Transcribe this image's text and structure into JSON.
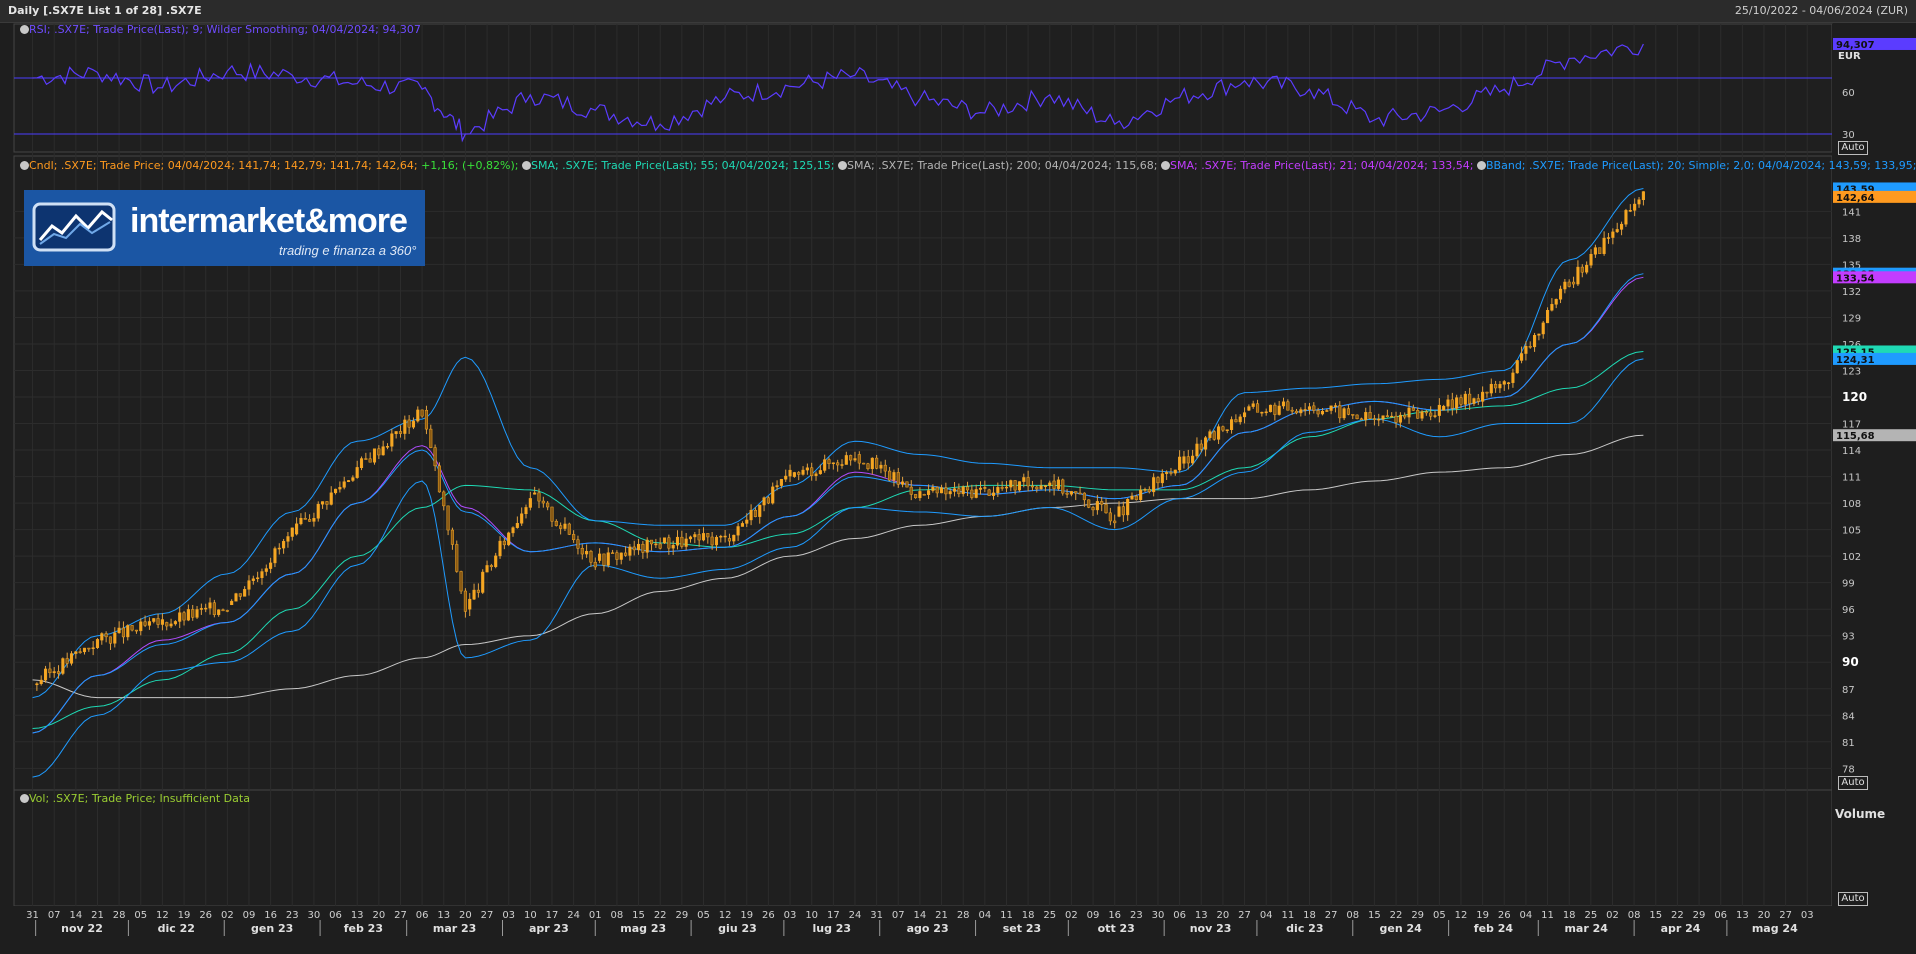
{
  "window": {
    "title": "Daily [.SX7E List 1 of 28] .SX7E",
    "date_range": "25/10/2022 - 04/06/2024 (ZUR)"
  },
  "rsi_panel": {
    "legend": "RSI; .SX7E; Trade Price(Last);  9; Wilder Smoothing; 04/04/2024; 94,307",
    "ticks": [
      "60",
      "30"
    ],
    "last_value": "94,307",
    "currency": "EUR",
    "auto_label": "Auto",
    "overbought": 70,
    "oversold": 30
  },
  "price_panel": {
    "legend": {
      "cndl": "Cndl; .SX7E; Trade Price; 04/04/2024; 141,74; 142,79; 141,74; 142,64; ",
      "cndl_change": "+1,16; (+0,82%);",
      "sma55": "SMA; .SX7E; Trade Price(Last);  55; 04/04/2024; 125,15;",
      "sma200": "SMA; .SX7E; Trade Price(Last);  200; 04/04/2024; 115,68;",
      "sma21": "SMA; .SX7E; Trade Price(Last);  21; 04/04/2024; 133,54;",
      "bband": "BBand; .SX7E; Trade Price(Last);  20; Simple; 2,0; 04/04/2024; 143,59; 133,95; 124,31"
    },
    "y_ticks": [
      "141",
      "138",
      "135",
      "132",
      "129",
      "126",
      "123",
      "120",
      "117",
      "114",
      "111",
      "108",
      "105",
      "102",
      "99",
      "96",
      "93",
      "90",
      "87",
      "84",
      "81",
      "78"
    ],
    "bold_ticks": [
      "120",
      "90"
    ],
    "price_tags": [
      {
        "label": "143,59",
        "value": 143.59,
        "color": "#1f9bff"
      },
      {
        "label": "142,64",
        "value": 142.64,
        "color": "#ff9a1f"
      },
      {
        "label": "133,95",
        "value": 133.95,
        "color": "#1f9bff"
      },
      {
        "label": "133,54",
        "value": 133.54,
        "color": "#c33dff"
      },
      {
        "label": "125,15",
        "value": 125.15,
        "color": "#1fd9b4"
      },
      {
        "label": "124,31",
        "value": 124.31,
        "color": "#1f9bff"
      },
      {
        "label": "115,68",
        "value": 115.68,
        "color": "#b4b4b4"
      }
    ],
    "auto_label": "Auto",
    "logo": {
      "name": "intermarket&more",
      "tagline": "trading e finanza a 360°"
    }
  },
  "volume_panel": {
    "legend": "Vol; .SX7E; Trade Price; Insufficient Data",
    "title": "Volume",
    "auto_label": "Auto"
  },
  "x_axis": {
    "day_ticks": [
      "31",
      "07",
      "14",
      "21",
      "28",
      "05",
      "12",
      "19",
      "26",
      "02",
      "09",
      "16",
      "23",
      "30",
      "06",
      "13",
      "20",
      "27",
      "06",
      "13",
      "20",
      "27",
      "03",
      "10",
      "17",
      "24",
      "01",
      "08",
      "15",
      "22",
      "29",
      "05",
      "12",
      "19",
      "26",
      "03",
      "10",
      "17",
      "24",
      "31",
      "07",
      "14",
      "21",
      "28",
      "04",
      "11",
      "18",
      "25",
      "02",
      "09",
      "16",
      "23",
      "30",
      "06",
      "13",
      "20",
      "27",
      "04",
      "11",
      "18",
      "27",
      "08",
      "15",
      "22",
      "29",
      "05",
      "12",
      "19",
      "26",
      "04",
      "11",
      "18",
      "25",
      "02",
      "08",
      "15",
      "22",
      "29",
      "06",
      "13",
      "20",
      "27",
      "03"
    ],
    "months": [
      "nov 22",
      "dic 22",
      "gen 23",
      "feb 23",
      "mar 23",
      "apr 23",
      "mag 23",
      "giu 23",
      "lug 23",
      "ago 23",
      "set 23",
      "ott 23",
      "nov 23",
      "dic 23",
      "gen 24",
      "feb 24",
      "mar 24",
      "apr 24",
      "mag 24"
    ]
  },
  "chart_data": [
    {
      "type": "line",
      "title": "RSI; .SX7E; Trade Price(Last);  9; Wilder Smoothing",
      "x": [
        "2022-10-31",
        "2022-11-21",
        "2022-12-12",
        "2023-01-02",
        "2023-01-23",
        "2023-02-13",
        "2023-03-06",
        "2023-03-20",
        "2023-04-10",
        "2023-05-01",
        "2023-05-22",
        "2023-06-12",
        "2023-07-03",
        "2023-07-24",
        "2023-08-14",
        "2023-09-04",
        "2023-09-25",
        "2023-10-16",
        "2023-11-06",
        "2023-11-27",
        "2023-12-18",
        "2024-01-08",
        "2024-01-29",
        "2024-02-19",
        "2024-03-11",
        "2024-04-04"
      ],
      "series": [
        {
          "name": "RSI",
          "values": [
            70,
            74,
            63,
            75,
            72,
            66,
            62,
            30,
            58,
            47,
            37,
            56,
            64,
            72,
            55,
            45,
            58,
            37,
            56,
            68,
            62,
            40,
            46,
            62,
            84,
            94.3
          ]
        }
      ],
      "ylim": [
        20,
        100
      ]
    },
    {
      "type": "line",
      "title": ".SX7E",
      "x": [
        "2022-10-31",
        "2022-11-21",
        "2022-12-12",
        "2023-01-02",
        "2023-01-23",
        "2023-02-13",
        "2023-03-06",
        "2023-03-20",
        "2023-04-10",
        "2023-05-01",
        "2023-05-22",
        "2023-06-12",
        "2023-07-03",
        "2023-07-24",
        "2023-08-14",
        "2023-09-04",
        "2023-09-25",
        "2023-10-16",
        "2023-11-06",
        "2023-11-27",
        "2023-12-18",
        "2024-01-08",
        "2024-01-29",
        "2024-02-19",
        "2024-03-11",
        "2024-04-04"
      ],
      "series": [
        {
          "name": "Cndl",
          "values": [
            87.5,
            92.5,
            94.5,
            96.5,
            104.5,
            112.0,
            118.5,
            96.0,
            109.0,
            101.5,
            103.5,
            104.0,
            111.0,
            113.5,
            109.0,
            109.5,
            110.5,
            106.5,
            112.5,
            118.5,
            119.0,
            117.5,
            118.5,
            121.5,
            133.0,
            142.64
          ]
        },
        {
          "name": "SMA 21",
          "values": [
            82.0,
            88.5,
            92.5,
            94.5,
            100.0,
            108.0,
            114.5,
            107.5,
            102.5,
            103.5,
            102.5,
            103.0,
            106.5,
            111.5,
            110.0,
            109.0,
            109.5,
            108.5,
            110.0,
            116.0,
            118.5,
            119.5,
            118.5,
            120.0,
            126.0,
            133.54
          ]
        },
        {
          "name": "SMA 55",
          "values": [
            82.5,
            85.0,
            88.0,
            91.0,
            96.0,
            102.0,
            107.5,
            110.0,
            109.5,
            106.0,
            103.5,
            103.0,
            104.5,
            107.5,
            109.5,
            110.0,
            110.0,
            109.5,
            109.5,
            112.0,
            115.5,
            117.5,
            118.5,
            119.0,
            121.0,
            125.15
          ]
        },
        {
          "name": "SMA 200",
          "values": [
            88.0,
            86.0,
            86.0,
            86.0,
            87.0,
            88.5,
            90.5,
            92.0,
            93.0,
            95.5,
            98.0,
            99.5,
            102.0,
            104.0,
            105.5,
            106.5,
            107.5,
            108.0,
            108.5,
            108.5,
            109.5,
            110.5,
            111.5,
            112.0,
            113.5,
            115.68
          ]
        },
        {
          "name": "BBand upper",
          "values": [
            86.0,
            93.0,
            95.5,
            100.0,
            107.0,
            115.0,
            117.5,
            124.5,
            112.0,
            106.0,
            105.5,
            105.5,
            110.0,
            115.0,
            113.5,
            112.5,
            112.0,
            112.0,
            111.5,
            120.5,
            121.0,
            121.5,
            122.0,
            123.0,
            135.5,
            143.59
          ]
        },
        {
          "name": "BBand middle",
          "values": [
            82.0,
            88.5,
            92.0,
            94.5,
            100.0,
            108.0,
            114.0,
            107.0,
            102.5,
            103.5,
            102.5,
            103.0,
            106.5,
            111.0,
            110.0,
            109.0,
            109.5,
            108.5,
            110.0,
            116.0,
            118.5,
            119.5,
            118.5,
            120.0,
            126.0,
            133.95
          ]
        },
        {
          "name": "BBand lower",
          "values": [
            77.0,
            84.0,
            89.0,
            90.0,
            93.5,
            101.0,
            110.5,
            90.5,
            92.5,
            101.0,
            99.5,
            100.5,
            103.0,
            107.5,
            107.0,
            106.5,
            107.5,
            105.0,
            108.5,
            111.5,
            116.0,
            117.5,
            115.5,
            117.0,
            117.0,
            124.31
          ]
        }
      ],
      "ylim": [
        76,
        145
      ]
    }
  ]
}
